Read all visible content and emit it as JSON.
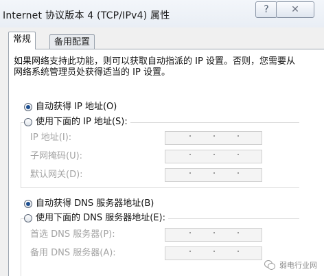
{
  "window": {
    "title": "Internet 协议版本 4 (TCP/IPv4) 属性",
    "help_label": "?",
    "close_label": "✕"
  },
  "tabs": [
    {
      "label": "常规",
      "active": true
    },
    {
      "label": "备用配置",
      "active": false
    }
  ],
  "description": "如果网络支持此功能，则可以获取自动指派的 IP 设置。否则，您需要从网络系统管理员处获得适当的 IP 设置。",
  "ip_section": {
    "auto_option": "自动获得 IP 地址(O)",
    "manual_option": "使用下面的 IP 地址(S):",
    "selected": "auto",
    "fields": [
      {
        "label": "IP 地址(I):"
      },
      {
        "label": "子网掩码(U):"
      },
      {
        "label": "默认网关(D):"
      }
    ]
  },
  "dns_section": {
    "auto_option": "自动获得 DNS 服务器地址(B)",
    "manual_option": "使用下面的 DNS 服务器地址(E):",
    "selected": "auto",
    "fields": [
      {
        "label": "首选 DNS 服务器(P):"
      },
      {
        "label": "备用 DNS 服务器(A):"
      }
    ]
  },
  "watermark": {
    "text": "弱电行业网",
    "icon": "wechat-icon"
  }
}
